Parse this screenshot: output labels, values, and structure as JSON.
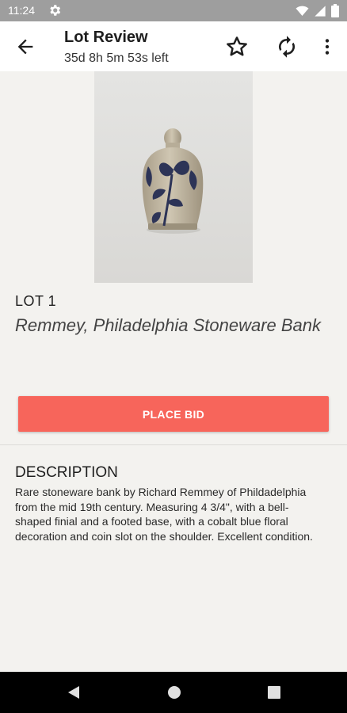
{
  "status_bar": {
    "time": "11:24",
    "icons": [
      "gear-icon",
      "wifi-icon",
      "signal-icon",
      "battery-icon"
    ]
  },
  "app_bar": {
    "title": "Lot Review",
    "subtitle": "35d 8h 5m 53s left",
    "icons": [
      "back-arrow-icon",
      "star-icon",
      "refresh-icon",
      "more-vert-icon"
    ]
  },
  "lot": {
    "number": "LOT 1",
    "title": "Remmey, Philadelphia Stoneware Bank",
    "image_subject": "stoneware bank with cobalt blue floral decoration"
  },
  "actions": {
    "place_bid_label": "PLACE BID"
  },
  "description": {
    "heading": "DESCRIPTION",
    "text": "Rare stoneware bank by Richard Remmey of Phildadelphia from the mid 19th century. Measuring 4 3/4\", with a bell-shaped finial and a footed base, with a cobalt blue floral decoration and coin slot on the shoulder. Excellent condition."
  },
  "colors": {
    "accent": "#f7655b",
    "background": "#f3f2ef",
    "app_bar": "#ffffff",
    "status_bar": "#9e9e9e",
    "nav_bar": "#000000"
  },
  "nav_bar": {
    "icons": [
      "nav-back-icon",
      "nav-home-icon",
      "nav-recents-icon"
    ]
  }
}
